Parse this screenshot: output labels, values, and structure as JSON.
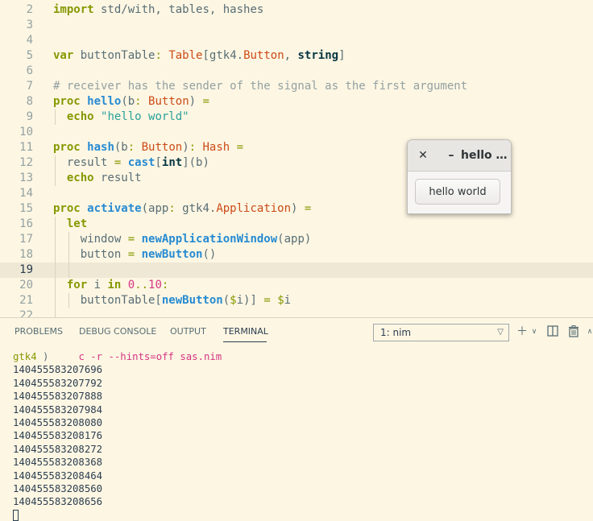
{
  "editor": {
    "lines": [
      {
        "n": "2",
        "tokens": [
          {
            "c": "kw",
            "t": "import"
          },
          {
            "c": "plain",
            "t": " std/with, tables, hashes"
          }
        ]
      },
      {
        "n": "3",
        "tokens": []
      },
      {
        "n": "4",
        "tokens": []
      },
      {
        "n": "5",
        "tokens": [
          {
            "c": "kw",
            "t": "var"
          },
          {
            "c": "plain",
            "t": " buttonTable"
          },
          {
            "c": "op",
            "t": ":"
          },
          {
            "c": "plain",
            "t": " "
          },
          {
            "c": "ty2",
            "t": "Table"
          },
          {
            "c": "plain",
            "t": "[gtk4."
          },
          {
            "c": "ty2",
            "t": "Button"
          },
          {
            "c": "plain",
            "t": ", "
          },
          {
            "c": "bt",
            "t": "string"
          },
          {
            "c": "plain",
            "t": "]"
          }
        ]
      },
      {
        "n": "6",
        "tokens": []
      },
      {
        "n": "7",
        "tokens": [
          {
            "c": "cm",
            "t": "# receiver has the sender of the signal as the first argument"
          }
        ]
      },
      {
        "n": "8",
        "tokens": [
          {
            "c": "kw",
            "t": "proc"
          },
          {
            "c": "plain",
            "t": " "
          },
          {
            "c": "fn",
            "t": "hello"
          },
          {
            "c": "plain",
            "t": "(b"
          },
          {
            "c": "op",
            "t": ":"
          },
          {
            "c": "plain",
            "t": " "
          },
          {
            "c": "ty2",
            "t": "Button"
          },
          {
            "c": "plain",
            "t": ") "
          },
          {
            "c": "op",
            "t": "="
          }
        ]
      },
      {
        "n": "9",
        "tokens": [
          {
            "c": "plain",
            "t": "  "
          },
          {
            "c": "kw",
            "t": "echo"
          },
          {
            "c": "plain",
            "t": " "
          },
          {
            "c": "str",
            "t": "\"hello world\""
          }
        ]
      },
      {
        "n": "10",
        "tokens": []
      },
      {
        "n": "11",
        "tokens": [
          {
            "c": "kw",
            "t": "proc"
          },
          {
            "c": "plain",
            "t": " "
          },
          {
            "c": "fn",
            "t": "hash"
          },
          {
            "c": "plain",
            "t": "(b"
          },
          {
            "c": "op",
            "t": ":"
          },
          {
            "c": "plain",
            "t": " "
          },
          {
            "c": "ty2",
            "t": "Button"
          },
          {
            "c": "plain",
            "t": ")"
          },
          {
            "c": "op",
            "t": ":"
          },
          {
            "c": "plain",
            "t": " "
          },
          {
            "c": "ty2",
            "t": "Hash"
          },
          {
            "c": "plain",
            "t": " "
          },
          {
            "c": "op",
            "t": "="
          }
        ]
      },
      {
        "n": "12",
        "tokens": [
          {
            "c": "plain",
            "t": "  result "
          },
          {
            "c": "op",
            "t": "="
          },
          {
            "c": "plain",
            "t": " "
          },
          {
            "c": "fn",
            "t": "cast"
          },
          {
            "c": "plain",
            "t": "["
          },
          {
            "c": "bt",
            "t": "int"
          },
          {
            "c": "plain",
            "t": "](b)"
          }
        ]
      },
      {
        "n": "13",
        "tokens": [
          {
            "c": "plain",
            "t": "  "
          },
          {
            "c": "kw",
            "t": "echo"
          },
          {
            "c": "plain",
            "t": " result"
          }
        ]
      },
      {
        "n": "14",
        "tokens": []
      },
      {
        "n": "15",
        "tokens": [
          {
            "c": "kw",
            "t": "proc"
          },
          {
            "c": "plain",
            "t": " "
          },
          {
            "c": "fn",
            "t": "activate"
          },
          {
            "c": "plain",
            "t": "(app"
          },
          {
            "c": "op",
            "t": ":"
          },
          {
            "c": "plain",
            "t": " gtk4."
          },
          {
            "c": "ty2",
            "t": "Application"
          },
          {
            "c": "plain",
            "t": ") "
          },
          {
            "c": "op",
            "t": "="
          }
        ]
      },
      {
        "n": "16",
        "tokens": [
          {
            "c": "plain",
            "t": "  "
          },
          {
            "c": "kw",
            "t": "let"
          }
        ]
      },
      {
        "n": "17",
        "tokens": [
          {
            "c": "plain",
            "t": "    window "
          },
          {
            "c": "op",
            "t": "="
          },
          {
            "c": "plain",
            "t": " "
          },
          {
            "c": "fn",
            "t": "newApplicationWindow"
          },
          {
            "c": "plain",
            "t": "(app)"
          }
        ]
      },
      {
        "n": "18",
        "tokens": [
          {
            "c": "plain",
            "t": "    button "
          },
          {
            "c": "op",
            "t": "="
          },
          {
            "c": "plain",
            "t": " "
          },
          {
            "c": "fn",
            "t": "newButton"
          },
          {
            "c": "plain",
            "t": "()"
          }
        ]
      },
      {
        "n": "19",
        "tokens": [],
        "current": true
      },
      {
        "n": "20",
        "tokens": [
          {
            "c": "plain",
            "t": "  "
          },
          {
            "c": "kw",
            "t": "for"
          },
          {
            "c": "plain",
            "t": " i "
          },
          {
            "c": "kw",
            "t": "in"
          },
          {
            "c": "plain",
            "t": " "
          },
          {
            "c": "num",
            "t": "0"
          },
          {
            "c": "op",
            "t": ".."
          },
          {
            "c": "num",
            "t": "10"
          },
          {
            "c": "op",
            "t": ":"
          }
        ]
      },
      {
        "n": "21",
        "tokens": [
          {
            "c": "plain",
            "t": "    buttonTable["
          },
          {
            "c": "fn",
            "t": "newButton"
          },
          {
            "c": "plain",
            "t": "("
          },
          {
            "c": "op",
            "t": "$"
          },
          {
            "c": "plain",
            "t": "i)] "
          },
          {
            "c": "op",
            "t": "="
          },
          {
            "c": "plain",
            "t": " "
          },
          {
            "c": "op",
            "t": "$"
          },
          {
            "c": "plain",
            "t": "i"
          }
        ]
      },
      {
        "n": "22",
        "tokens": []
      }
    ]
  },
  "gtk_window": {
    "close_glyph": "✕",
    "minimize_glyph": "–",
    "title": "hello …",
    "button_label": "hello world"
  },
  "panel": {
    "tabs": [
      {
        "label": "PROBLEMS"
      },
      {
        "label": "DEBUG CONSOLE"
      },
      {
        "label": "OUTPUT"
      },
      {
        "label": "TERMINAL",
        "active": true
      }
    ],
    "terminal_select": "1: nim",
    "icons": [
      "plus-icon",
      "chevron-down-icon",
      "split-terminal-icon",
      "trash-icon",
      "chevron-up-icon"
    ]
  },
  "terminal": {
    "prompt_dir": "gtk4",
    "prompt_arrow": ")",
    "command": "c -r --hints=off sas.nim",
    "output": [
      "140455583207696",
      "140455583207792",
      "140455583207888",
      "140455583207984",
      "140455583208080",
      "140455583208176",
      "140455583208272",
      "140455583208368",
      "140455583208464",
      "140455583208560",
      "140455583208656"
    ]
  }
}
